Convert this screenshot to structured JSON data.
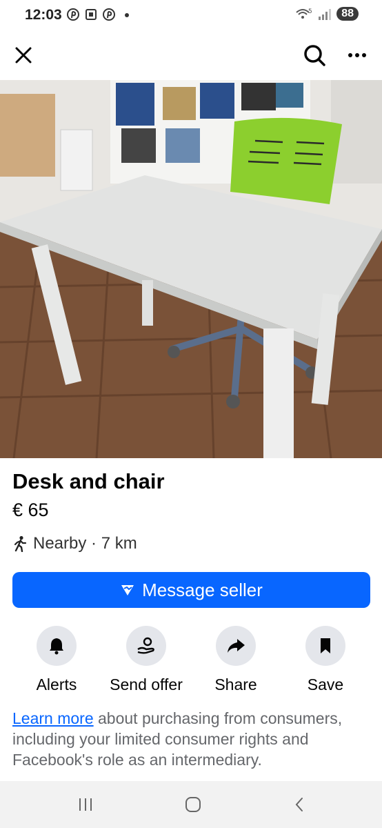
{
  "status_bar": {
    "time": "12:03",
    "icons": [
      "pinterest-icon",
      "screenshot-icon",
      "pinterest-icon",
      "dot-icon"
    ],
    "battery": "88",
    "wifi_label": "5"
  },
  "topbar": {
    "icons": [
      "close-icon",
      "search-icon",
      "more-icon"
    ]
  },
  "photo": {
    "pages": 4,
    "active_page": 1
  },
  "listing": {
    "title": "Desk and chair",
    "price": "€ 65",
    "location": "Nearby · 7 km"
  },
  "message_button": {
    "label": "Message seller"
  },
  "actions": [
    {
      "label": "Alerts",
      "icon": "bell-icon"
    },
    {
      "label": "Send offer",
      "icon": "offer-icon"
    },
    {
      "label": "Share",
      "icon": "share-icon"
    },
    {
      "label": "Save",
      "icon": "bookmark-icon"
    }
  ],
  "info": {
    "link_text": "Learn more",
    "text": " about purchasing from consumers, including your limited consumer rights and Facebook's role as an intermediary."
  },
  "colors": {
    "accent": "#0866ff",
    "button_bg": "#e4e6eb",
    "secondary_text": "#65676b"
  }
}
